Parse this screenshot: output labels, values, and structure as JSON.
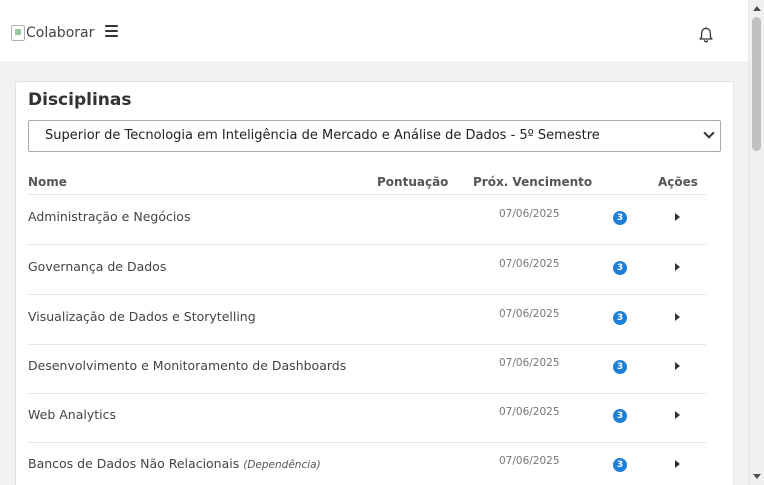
{
  "header": {
    "logo_alt": "Colaborar",
    "menu_icon": "hamburger-menu-icon",
    "notification_icon": "bell-icon"
  },
  "card": {
    "title": "Disciplinas",
    "course_select": {
      "selected": "Superior de Tecnologia em Inteligência de Mercado e Análise de Dados - 5º Semestre"
    },
    "table": {
      "columns": [
        "Nome",
        "Pontuação",
        "Próx. Vencimento",
        "Ações"
      ],
      "rows": [
        {
          "name": "Administração e Negócios",
          "note": "",
          "score": "",
          "due": "07/06/2025",
          "badge": "3"
        },
        {
          "name": "Governança de Dados",
          "note": "",
          "score": "",
          "due": "07/06/2025",
          "badge": "3"
        },
        {
          "name": "Visualização de Dados e Storytelling",
          "note": "",
          "score": "",
          "due": "07/06/2025",
          "badge": "3"
        },
        {
          "name": "Desenvolvimento e Monitoramento de Dashboards",
          "note": "",
          "score": "",
          "due": "07/06/2025",
          "badge": "3"
        },
        {
          "name": "Web Analytics",
          "note": "",
          "score": "",
          "due": "07/06/2025",
          "badge": "3"
        },
        {
          "name": "Bancos de Dados Não Relacionais",
          "note": "(Dependência)",
          "score": "",
          "due": "07/06/2025",
          "badge": "3"
        }
      ]
    }
  },
  "colors": {
    "badge": "#1e7fd6",
    "page_bg": "#f2f2f2",
    "card_bg": "#ffffff"
  }
}
